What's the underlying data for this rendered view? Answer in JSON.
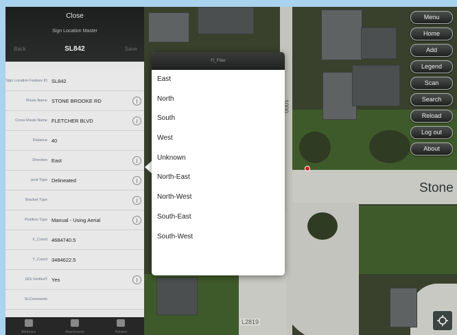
{
  "panel": {
    "close_label": "Close",
    "title": "Sign Location Master",
    "back_label": "Back",
    "record_id": "SL842",
    "save_label": "Save",
    "fields": [
      {
        "label": "Sign Location Feature ID",
        "value": "SL842",
        "info": false
      },
      {
        "label": "Route Name",
        "value": "STONE BROOKE RD",
        "info": true
      },
      {
        "label": "Cross Route Name",
        "value": "FLETCHER BLVD",
        "info": true
      },
      {
        "label": "Distance",
        "value": "40",
        "info": false
      },
      {
        "label": "Direction",
        "value": "East",
        "info": true
      },
      {
        "label": "post Type",
        "value": "Delineated",
        "info": true
      },
      {
        "label": "Bracket Type",
        "value": "",
        "info": true
      },
      {
        "label": "Position Type",
        "value": "Manual - Using Aerial",
        "info": true
      },
      {
        "label": "X_Coord",
        "value": "4684740.5",
        "info": false
      },
      {
        "label": "Y_Coord",
        "value": "3484622.5",
        "info": false
      },
      {
        "label": "GIS Verified?",
        "value": "Yes",
        "info": true
      },
      {
        "label": "SLComments",
        "value": "",
        "info": false
      }
    ],
    "tabs": [
      "Attributes",
      "Attachments",
      "Related"
    ]
  },
  "popover": {
    "title": "Fl_Filter",
    "options": [
      "East",
      "North",
      "South",
      "West",
      "Unknown",
      "North-East",
      "North-West",
      "South-East",
      "South-West"
    ]
  },
  "map": {
    "street_label": "Stone B",
    "vertical_road_label": "1000",
    "parcel_label": "L2819",
    "menu": [
      "Menu",
      "Home",
      "Add",
      "Legend",
      "Scan",
      "Search",
      "Reload",
      "Log out",
      "About"
    ]
  },
  "colors": {
    "panel_header": "#1d1e1e",
    "panel_body": "#e6e6e6",
    "marker": "#e21818",
    "menu_button": "#2f3230",
    "frame_background": "#a9d3ee"
  }
}
